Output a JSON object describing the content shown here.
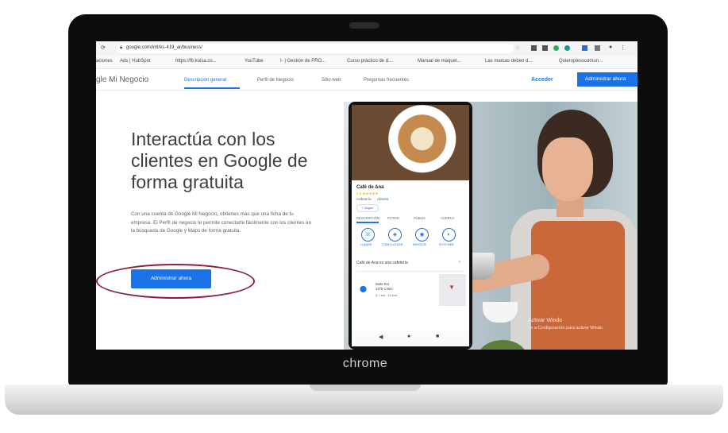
{
  "laptop": {
    "brand": "chrome"
  },
  "browser": {
    "url": "google.com/intl/es-419_ar/business/",
    "bookmarks": [
      "aciones",
      "Ads | HubSpot",
      "https://fb.koisa.co...",
      "YouTube",
      "I- | Gestión de PRO...",
      "Curso práctico de d...",
      "Manual de maquet...",
      "Las marcas deben d...",
      "Quieroplesscomun..."
    ]
  },
  "site": {
    "logo": "gle Mi Negocio",
    "nav": [
      "Descripción general",
      "Perfil de Negocio",
      "Sitio web",
      "Preguntas frecuentes"
    ],
    "signin": "Acceder",
    "admin_top": "Administrar ahora"
  },
  "hero": {
    "headline": "Interactúa con los clientes en Google de forma gratuita",
    "description": "Con una cuenta de Google Mi Negocio, obtienes más que una ficha de tu empresa. El Perfil de negocio te permite conectarte fácilmente con los clientes en la búsqueda de Google y Maps de forma gratuita.",
    "cta": "Administrar ahora"
  },
  "phone": {
    "name": "Café de Ana",
    "rating": "4.8 ★★★★★",
    "type": "Cafetería ·",
    "status": "Abierto",
    "follow": "+ Seguir",
    "tabs": [
      "DESCRIPCIÓN",
      "FOTOS",
      "PÚBLIC",
      "ACERCA"
    ],
    "actions": [
      {
        "icon": "☏",
        "label": "LLAMAR"
      },
      {
        "icon": "◈",
        "label": "CÓMO LLEGAR"
      },
      {
        "icon": "◉",
        "label": "MENSAJE"
      },
      {
        "icon": "◐",
        "label": "SITIO WEB"
      }
    ],
    "about": "Café de Ana es una cafetería",
    "chevron": "›",
    "address": [
      "Suite 911",
      "1278 CABA",
      "2,7 km · 10 min"
    ],
    "navbar": [
      "◀",
      "●",
      "■"
    ]
  },
  "watermark": {
    "line1": "Activar Windo",
    "line2": "Ve a Configuración para activar Windo"
  },
  "colors": {
    "accent": "#1a73e8",
    "annotation": "#8b1e3f"
  }
}
